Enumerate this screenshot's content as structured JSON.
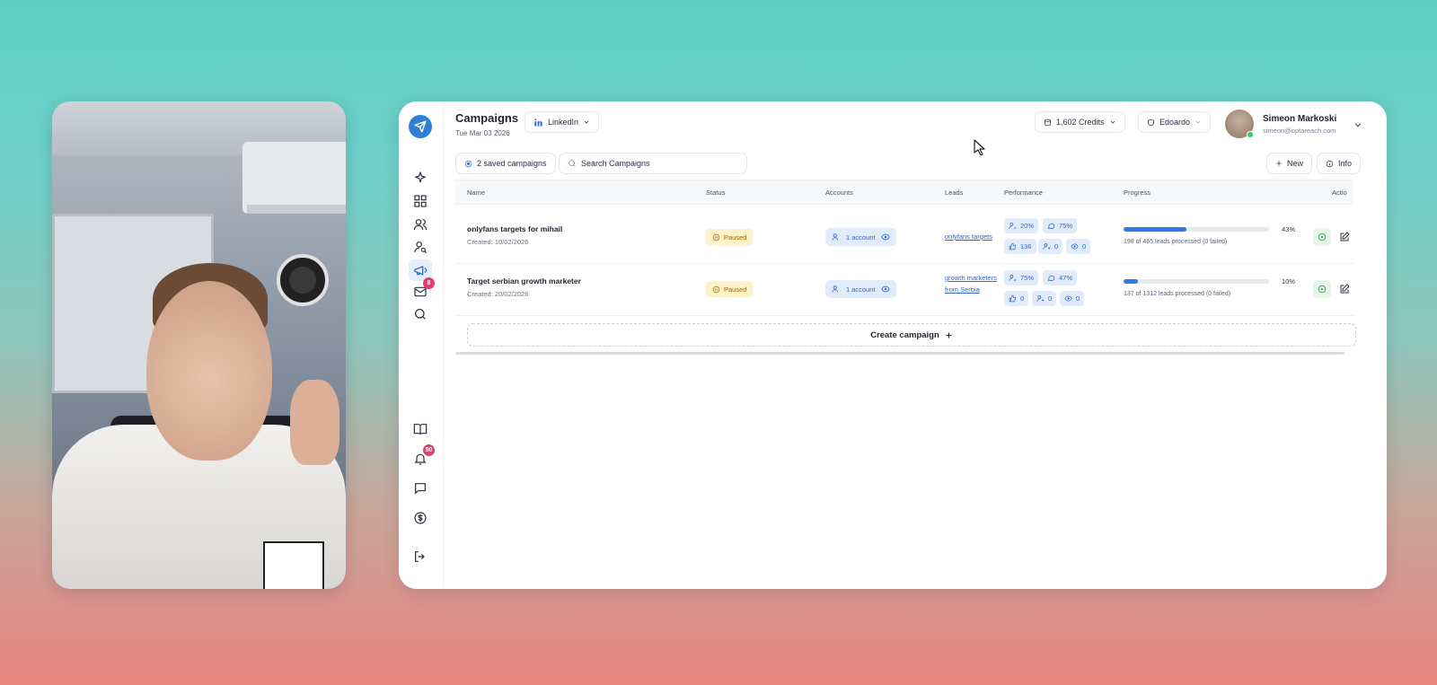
{
  "app": {
    "title": "Campaigns",
    "date": "Tue Mar 03 2026",
    "platform_label": "LinkedIn",
    "credits_label": "1,602 Credits",
    "workspace_label": "Edoardo",
    "user": {
      "name": "Simeon Markoski",
      "email": "simeon@optareach.com"
    }
  },
  "sidebar": {
    "messages_badge": "8",
    "notifications_badge": "50"
  },
  "toolbar": {
    "saved_campaigns_label": "2 saved campaigns",
    "search_placeholder": "Search Campaigns",
    "new_label": "New",
    "info_label": "Info"
  },
  "table": {
    "headers": {
      "name": "Name",
      "status": "Status",
      "accounts": "Accounts",
      "leads": "Leads",
      "performance": "Performance",
      "progress": "Progress",
      "actions": "Actio"
    },
    "rows": [
      {
        "name": "onlyfans targets for mihail",
        "created": "Created: 10/02/2026",
        "status": "Paused",
        "accounts": "1 account",
        "leads": "onlyfans targets",
        "perf": {
          "accept": "20%",
          "reply": "75%",
          "likes": "136",
          "follows": "0",
          "views": "0"
        },
        "progress_pct": "43%",
        "progress_value": 0.43,
        "progress_text": "198 of 465 leads processed (0 failed)"
      },
      {
        "name": "Target serbian growth marketer",
        "created": "Created: 20/02/2026",
        "status": "Paused",
        "accounts": "1 account",
        "leads": "growth marketers from Serbia",
        "perf": {
          "accept": "75%",
          "reply": "47%",
          "likes": "0",
          "follows": "0",
          "views": "0"
        },
        "progress_pct": "10%",
        "progress_value": 0.1,
        "progress_text": "137 of 1312 leads processed (0 failed)"
      }
    ]
  },
  "create_campaign_label": "Create campaign",
  "colors": {
    "accent": "#2f7ae5",
    "paused_bg": "#fdf2c9",
    "paused_text": "#9a6a00",
    "badge": "#e63a6b"
  }
}
